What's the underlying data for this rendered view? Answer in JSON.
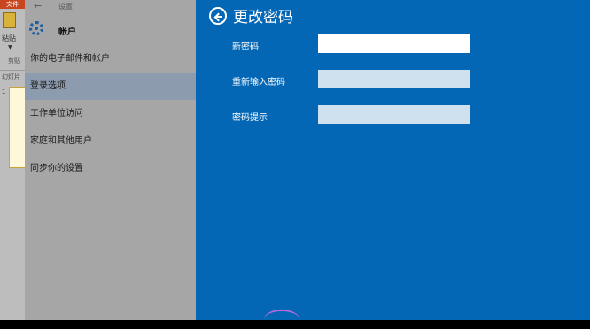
{
  "background_app": {
    "file_tab": "文件",
    "paste_label": "粘贴",
    "clipboard_label": "剪贴",
    "slides_label": "幻灯片",
    "slide_number": "1"
  },
  "sidebar": {
    "header_label": "设置",
    "title": "帐户",
    "items": [
      {
        "label": "你的电子邮件和帐户"
      },
      {
        "label": "登录选项"
      },
      {
        "label": "工作单位访问"
      },
      {
        "label": "家庭和其他用户"
      },
      {
        "label": "同步你的设置"
      }
    ]
  },
  "dialog": {
    "title": "更改密码",
    "fields": [
      {
        "label": "新密码",
        "value": ""
      },
      {
        "label": "重新输入密码",
        "value": ""
      },
      {
        "label": "密码提示",
        "value": ""
      }
    ]
  },
  "colors": {
    "dialog_background": "#0467b5",
    "sidebar_background": "#a6a6a6",
    "active_item": "#8c9bad"
  }
}
